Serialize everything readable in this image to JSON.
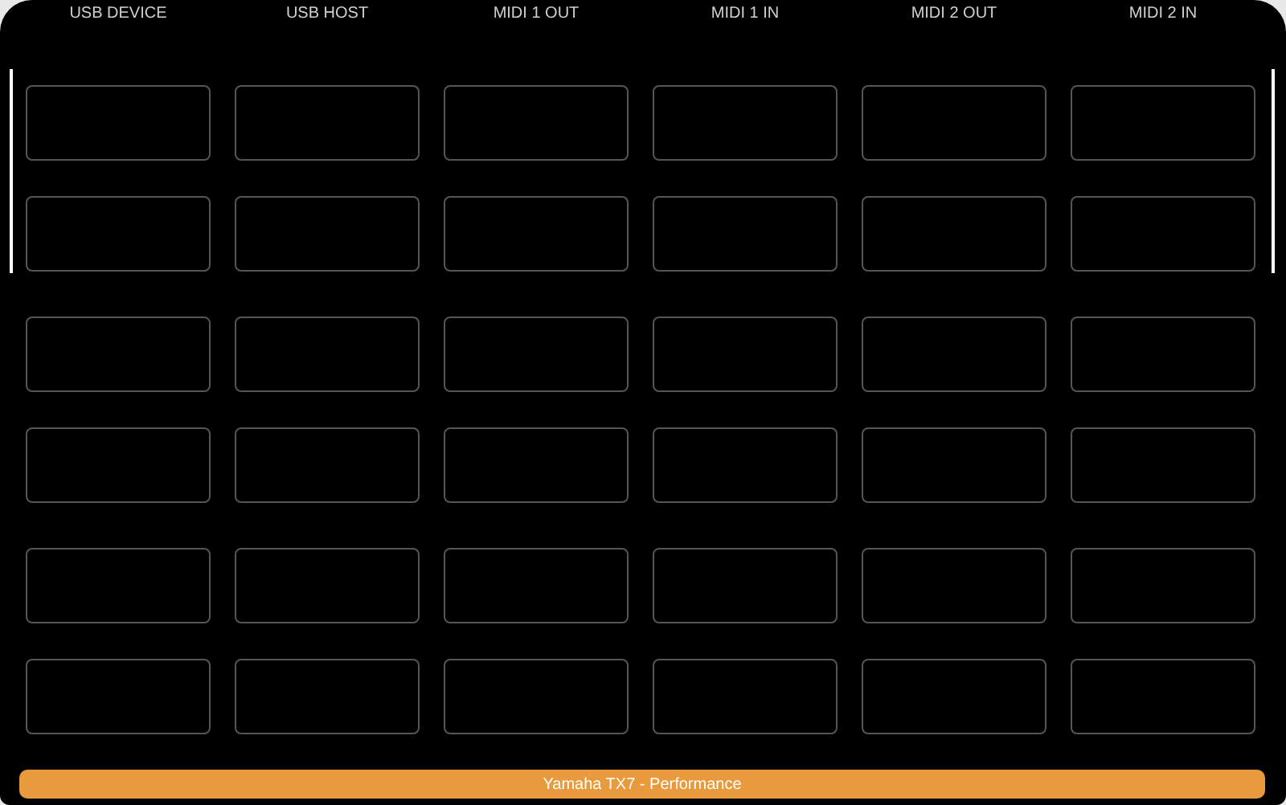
{
  "columns": [
    "USB DEVICE",
    "USB HOST",
    "MIDI 1 OUT",
    "MIDI 1 IN",
    "MIDI 2 OUT",
    "MIDI 2 IN"
  ],
  "groups": [
    {
      "selected": true
    },
    {
      "selected": false
    },
    {
      "selected": false
    }
  ],
  "footer": {
    "title": "Yamaha TX7 - Performance"
  }
}
